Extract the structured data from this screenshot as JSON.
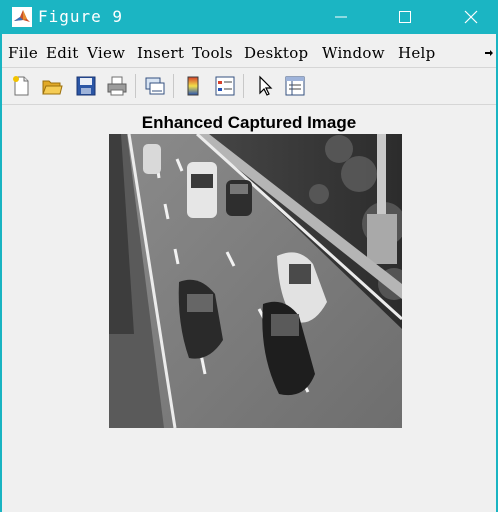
{
  "window": {
    "title": "Figure 9",
    "controls": [
      "minimize",
      "maximize",
      "close"
    ],
    "accent_color": "#1bb5c3"
  },
  "menu": {
    "items": [
      "File",
      "Edit",
      "View",
      "Insert",
      "Tools",
      "Desktop",
      "Window",
      "Help"
    ]
  },
  "toolbar": {
    "tools": [
      {
        "name": "new-figure-icon"
      },
      {
        "name": "open-file-icon"
      },
      {
        "name": "save-icon"
      },
      {
        "name": "print-icon"
      },
      {
        "name": "link-figure-icon"
      },
      {
        "name": "insert-colorbar-icon"
      },
      {
        "name": "insert-legend-icon"
      },
      {
        "name": "edit-plot-arrow-icon"
      },
      {
        "name": "property-inspector-icon"
      }
    ]
  },
  "figure": {
    "title": "Enhanced Captured Image",
    "image_description_icon": "grayscale-traffic-photo"
  }
}
